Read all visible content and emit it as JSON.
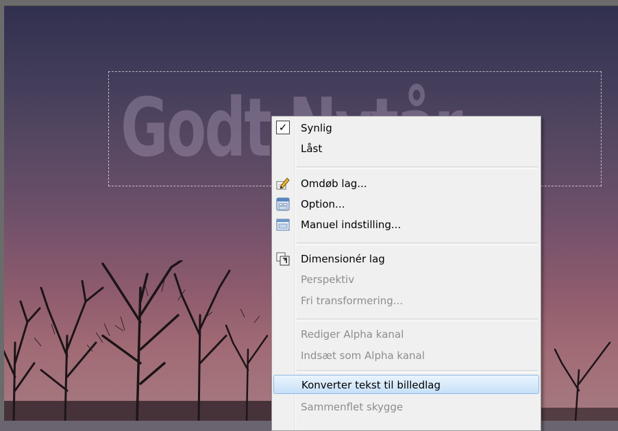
{
  "canvas": {
    "layer_text": "Godt Nytår"
  },
  "menu": {
    "items": [
      {
        "label": "Synlig",
        "checked": true,
        "enabled": true,
        "icon": "check-icon"
      },
      {
        "label": "Låst",
        "enabled": true
      },
      {
        "label": "Omdøb lag...",
        "enabled": true,
        "icon": "rename-pencil-icon"
      },
      {
        "label": "Option...",
        "enabled": true,
        "icon": "options-window-icon"
      },
      {
        "label": "Manuel indstilling...",
        "enabled": true,
        "icon": "manual-settings-window-icon"
      },
      {
        "label": "Dimensionér lag",
        "enabled": true,
        "icon": "resize-layer-icon"
      },
      {
        "label": "Perspektiv",
        "enabled": false
      },
      {
        "label": "Fri transformering...",
        "enabled": false
      },
      {
        "label": "Rediger Alpha kanal",
        "enabled": false
      },
      {
        "label": "Indsæt som Alpha kanal",
        "enabled": false
      },
      {
        "label": "Konverter tekst til billedlag",
        "enabled": true,
        "highlighted": true
      },
      {
        "label": "Sammenflet skygge",
        "enabled": false
      }
    ]
  },
  "colors": {
    "highlight": "#c6e0f8",
    "disabled_text": "#8d8d8d"
  }
}
